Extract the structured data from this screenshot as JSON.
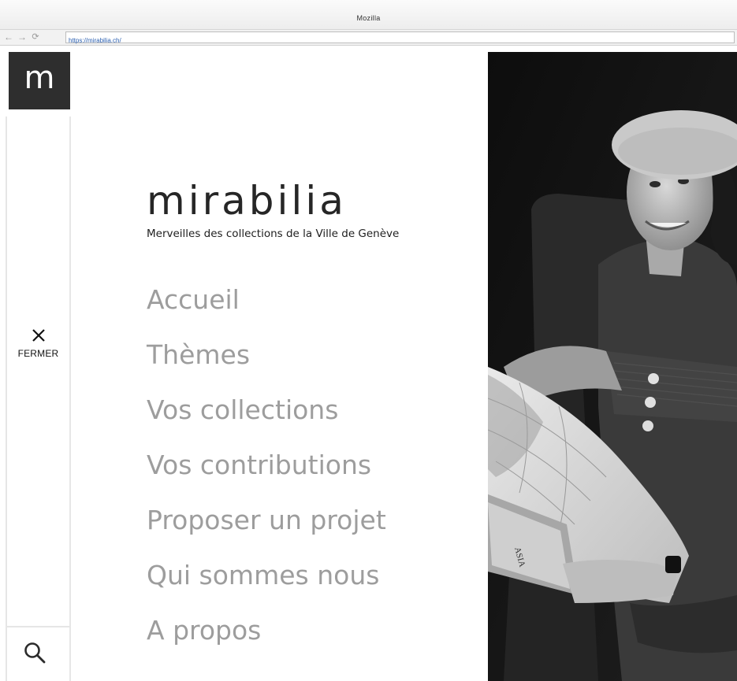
{
  "browser": {
    "window_title": "Mozilla",
    "url": "https://mirabilia.ch/",
    "nav_icons": {
      "back": "arrow-left-icon",
      "forward": "arrow-right-icon",
      "reload": "reload-icon"
    }
  },
  "sidebar": {
    "logo_letter": "m",
    "close_label": "FERMER",
    "close_icon": "close-icon",
    "search_icon": "search-icon"
  },
  "menu": {
    "brand": "mirabilia",
    "tagline": "Merveilles des collections de la Ville de Genève",
    "items": [
      {
        "label": "Accueil"
      },
      {
        "label": "Thèmes"
      },
      {
        "label": "Vos collections"
      },
      {
        "label": "Vos contributions"
      },
      {
        "label": "Proposer un projet"
      },
      {
        "label": "Qui sommes nous"
      },
      {
        "label": "A propos"
      }
    ]
  },
  "colors": {
    "logo_tile": "#2e2e2e",
    "menu_text": "#9d9d9d",
    "brand_text": "#262626",
    "url_text": "#2a5fb0"
  }
}
